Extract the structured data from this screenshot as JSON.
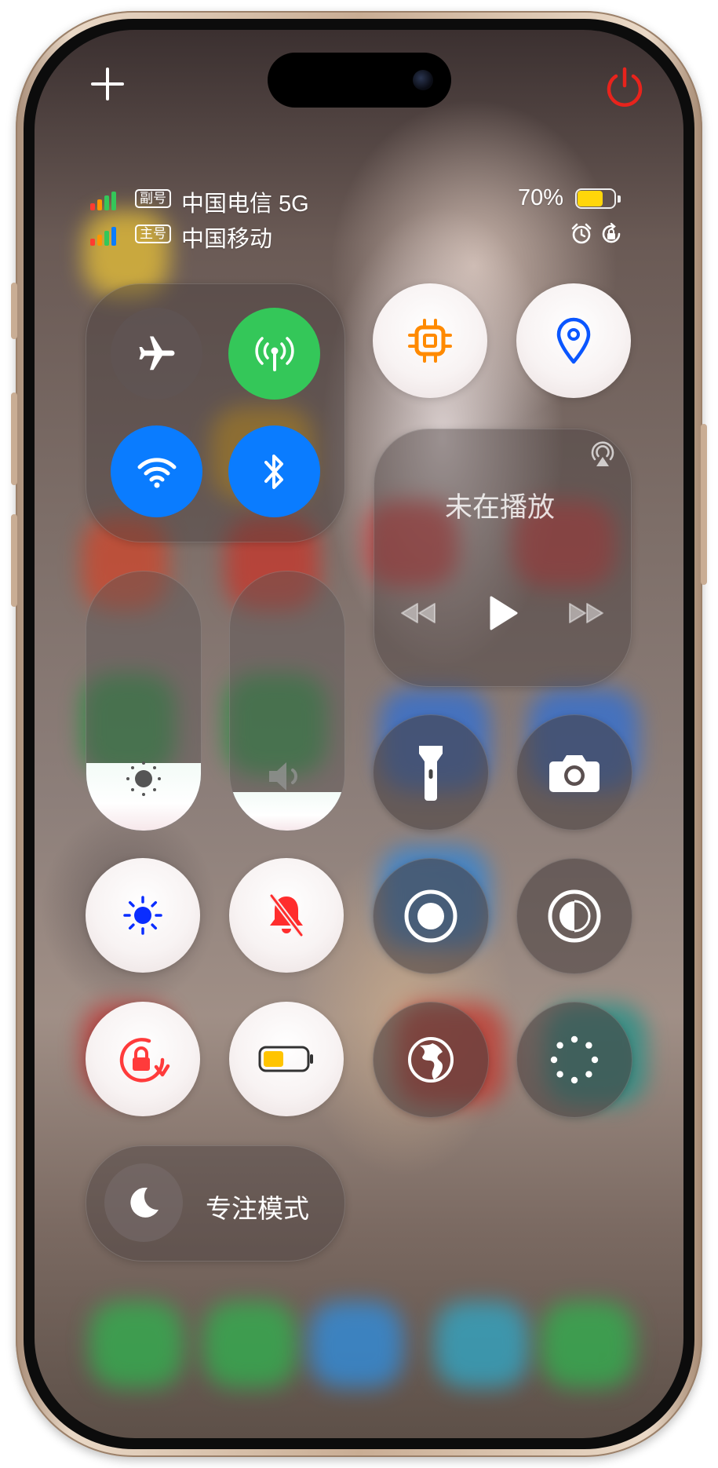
{
  "device": {
    "frame": "iPhone"
  },
  "header": {
    "add_icon": "plus-icon",
    "power_icon": "power-icon",
    "power_color": "#e8231c"
  },
  "status_bar": {
    "sim2": {
      "badge": "副号",
      "carrier": "中国电信 5G"
    },
    "sim1": {
      "badge": "主号",
      "carrier": "中国移动"
    },
    "battery_percent": "70%",
    "battery_level": 0.7,
    "battery_color": "#ffd60a",
    "alarm_icon": "alarm-clock-icon",
    "orientation_lock_icon": "orientation-lock-icon"
  },
  "connectivity": {
    "airplane": {
      "icon": "airplane-icon",
      "active": false
    },
    "cellular": {
      "icon": "cellular-antenna-icon",
      "active": true,
      "color": "#34c759"
    },
    "wifi": {
      "icon": "wifi-icon",
      "active": true,
      "color": "#0a7cff"
    },
    "bluetooth": {
      "icon": "bluetooth-icon",
      "active": true,
      "color": "#0a7cff"
    }
  },
  "shortcuts": {
    "performance": {
      "icon": "chip-icon",
      "color": "#ff8a00"
    },
    "location": {
      "icon": "location-pin-icon",
      "color": "#0a56ff"
    }
  },
  "media": {
    "title": "未在播放",
    "airplay_icon": "airplay-audio-icon",
    "prev_icon": "rewind-icon",
    "play_icon": "play-icon",
    "next_icon": "fast-forward-icon"
  },
  "sliders": {
    "brightness": {
      "icon": "brightness-sun-icon",
      "level": 0.26
    },
    "volume": {
      "icon": "speaker-icon",
      "level": 0.15
    }
  },
  "tiles": {
    "flashlight": {
      "icon": "flashlight-icon"
    },
    "camera": {
      "icon": "camera-icon"
    },
    "true_tone": {
      "icon": "sun-icon",
      "active": true,
      "color": "#0a2dff"
    },
    "silent_mode": {
      "icon": "bell-slash-icon",
      "active": true,
      "color": "#ff2d2d"
    },
    "screen_record": {
      "icon": "screen-record-icon"
    },
    "dark_mode": {
      "icon": "dark-mode-icon"
    },
    "rotation_lock": {
      "icon": "rotation-lock-icon",
      "active": true,
      "color": "#ff3b3b"
    },
    "low_power": {
      "icon": "battery-icon",
      "active": true,
      "color": "#ffc400"
    },
    "globe": {
      "icon": "globe-icon"
    },
    "loading": {
      "icon": "spinner-icon"
    }
  },
  "focus": {
    "icon": "moon-icon",
    "label": "专注模式"
  }
}
